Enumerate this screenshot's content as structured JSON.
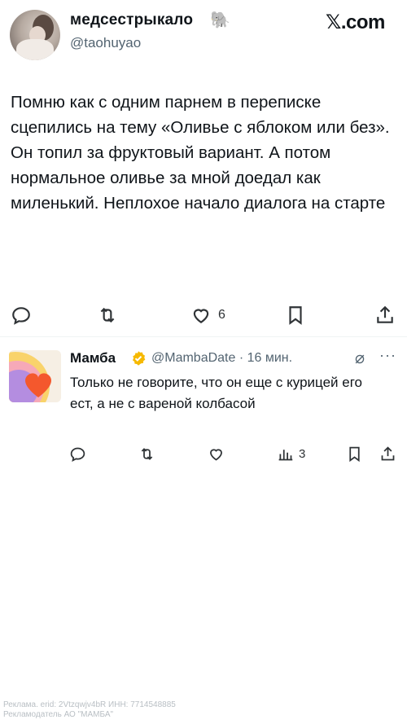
{
  "post": {
    "display_name": "медсестрыкало",
    "name_emoji": "🐘",
    "handle": "@taohuyao",
    "brand": {
      "x": "𝕏",
      "suffix": ".com"
    },
    "text": "Помню как с одним парнем в переписке сцепились на тему «Оливье с яблоком или без». Он топил за фруктовый вариант. А потом нормальное оливье за мной доедал как миленький. Неплохое начало диалога на старте",
    "actions": {
      "reply": "reply-icon",
      "retweet": "retweet-icon",
      "like_count": "6",
      "bookmark": "bookmark-icon",
      "share": "share-icon"
    }
  },
  "reply": {
    "display_name": "Мамба",
    "verified_color": "#f6b900",
    "handle": "@MambaDate",
    "separator": "·",
    "time": "16 мин.",
    "more": "···",
    "text": "Только не говорите, что он еще с курицей его ест, а не с вареной колбасой",
    "actions": {
      "views_count": "3"
    }
  },
  "ad_disclaimer": {
    "line1": "Реклама. erid: 2Vtzqwjv4bR ИНН: 7714548885",
    "line2": "Рекламодатель АО \"МАМБА\""
  }
}
